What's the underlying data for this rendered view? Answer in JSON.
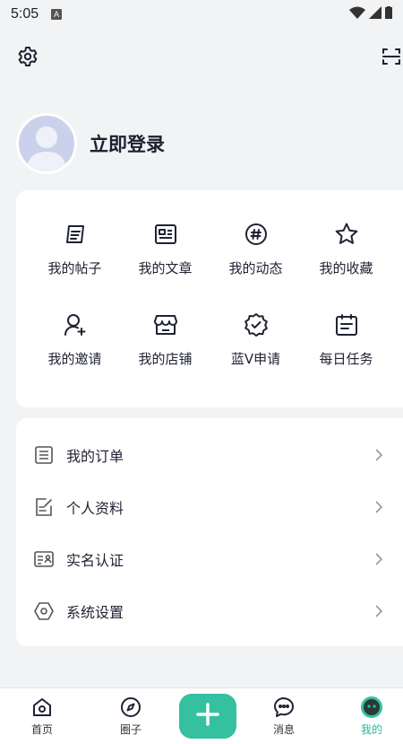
{
  "status_bar": {
    "time": "5:05",
    "app_badge": "A"
  },
  "profile": {
    "login_label": "立即登录"
  },
  "grid": [
    {
      "label": "我的帖子",
      "icon": "post-icon"
    },
    {
      "label": "我的文章",
      "icon": "article-icon"
    },
    {
      "label": "我的动态",
      "icon": "hashtag-icon"
    },
    {
      "label": "我的收藏",
      "icon": "star-icon"
    },
    {
      "label": "我的邀请",
      "icon": "invite-user-icon"
    },
    {
      "label": "我的店铺",
      "icon": "store-icon"
    },
    {
      "label": "蓝V申请",
      "icon": "verified-badge-icon"
    },
    {
      "label": "每日任务",
      "icon": "calendar-task-icon"
    }
  ],
  "menu": [
    {
      "label": "我的订单",
      "icon": "order-list-icon"
    },
    {
      "label": "个人资料",
      "icon": "edit-profile-icon"
    },
    {
      "label": "实名认证",
      "icon": "id-card-icon"
    },
    {
      "label": "系统设置",
      "icon": "settings-hexagon-icon"
    }
  ],
  "tabs": {
    "home": "首页",
    "circle": "圈子",
    "messages": "消息",
    "mine": "我的"
  },
  "colors": {
    "accent": "#35c0a0",
    "active_tab": "#2bb59a",
    "background": "#f2f3f5"
  }
}
